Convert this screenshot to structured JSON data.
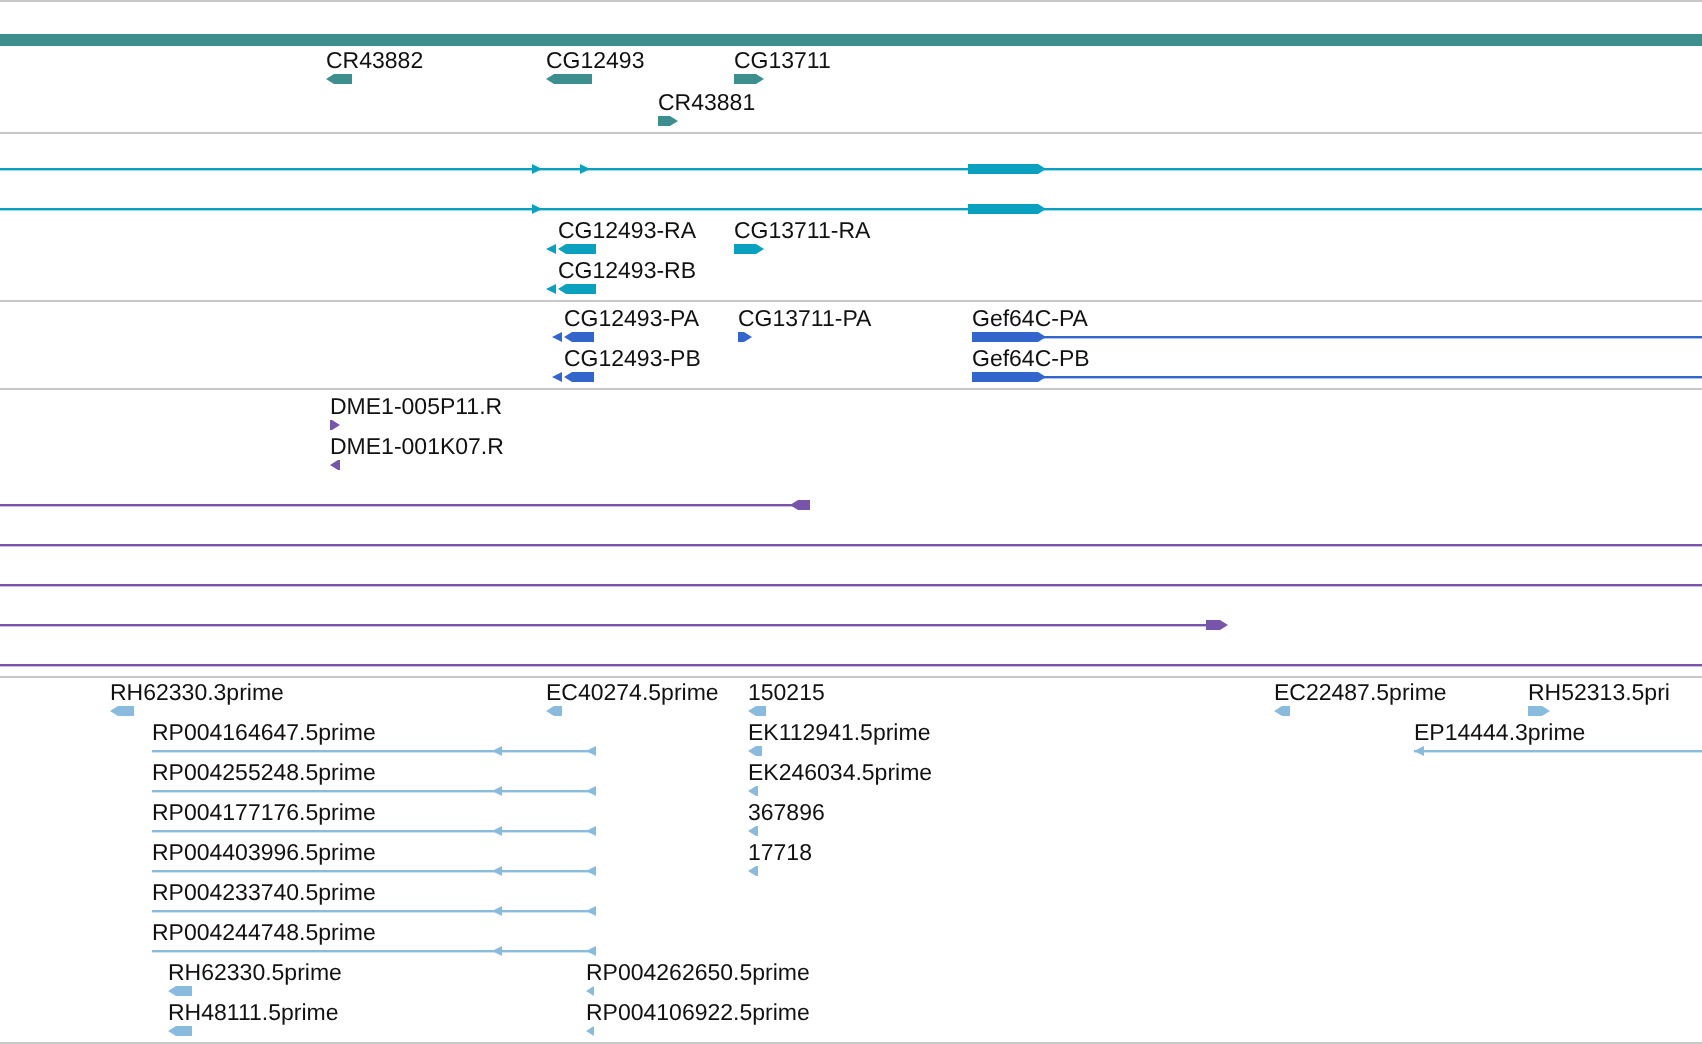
{
  "tracks": [
    {
      "color": "#3d8f8f",
      "features": [
        {
          "label": "CR43882",
          "reverse": true
        },
        {
          "label": "CG12493",
          "reverse": true
        },
        {
          "label": "CG13711",
          "reverse": false
        },
        {
          "label": "CR43881",
          "reverse": false
        }
      ]
    },
    {
      "color": "#0aa0c0",
      "features": [
        {
          "reverse": false
        },
        {
          "reverse": false
        },
        {
          "label": "CG12493-RA",
          "reverse": true
        },
        {
          "label": "CG13711-RA",
          "reverse": false
        },
        {
          "label": "CG12493-RB",
          "reverse": true
        }
      ]
    },
    {
      "color": "#3366cc",
      "features": [
        {
          "label": "CG12493-PA",
          "reverse": true
        },
        {
          "label": "CG13711-PA",
          "reverse": false
        },
        {
          "label": "Gef64C-PA",
          "reverse": false
        },
        {
          "label": "CG12493-PB",
          "reverse": true
        },
        {
          "label": "Gef64C-PB",
          "reverse": false
        }
      ]
    },
    {
      "color": "#7755aa",
      "features": [
        {
          "label": "DME1-005P11.R",
          "reverse": false
        },
        {
          "label": "DME1-001K07.R",
          "reverse": true
        },
        {
          "reverse": true
        },
        {
          "reverse": false
        },
        {
          "reverse": false
        },
        {
          "reverse": false
        },
        {
          "reverse": false
        }
      ]
    },
    {
      "color": "#88bbdd",
      "features": [
        {
          "label": "RH62330.3prime",
          "reverse": true
        },
        {
          "label": "EC40274.5prime",
          "reverse": true
        },
        {
          "label": "150215",
          "reverse": true
        },
        {
          "label": "EC22487.5prime",
          "reverse": true
        },
        {
          "label": "RH52313.5pri",
          "reverse": false
        },
        {
          "label": "RP004164647.5prime",
          "reverse": true
        },
        {
          "label": "EK112941.5prime",
          "reverse": true
        },
        {
          "label": "EP14444.3prime",
          "reverse": true
        },
        {
          "label": "RP004255248.5prime",
          "reverse": true
        },
        {
          "label": "EK246034.5prime",
          "reverse": true
        },
        {
          "label": "RP004177176.5prime",
          "reverse": true
        },
        {
          "label": "367896",
          "reverse": true
        },
        {
          "label": "RP004403996.5prime",
          "reverse": true
        },
        {
          "label": "17718",
          "reverse": true
        },
        {
          "label": "RP004233740.5prime",
          "reverse": true
        },
        {
          "label": "RP004244748.5prime",
          "reverse": true
        },
        {
          "label": "RH62330.5prime",
          "reverse": true
        },
        {
          "label": "RP004262650.5prime",
          "reverse": true
        },
        {
          "label": "RH48111.5prime",
          "reverse": true
        },
        {
          "label": "RP004106922.5prime",
          "reverse": true
        }
      ]
    }
  ]
}
